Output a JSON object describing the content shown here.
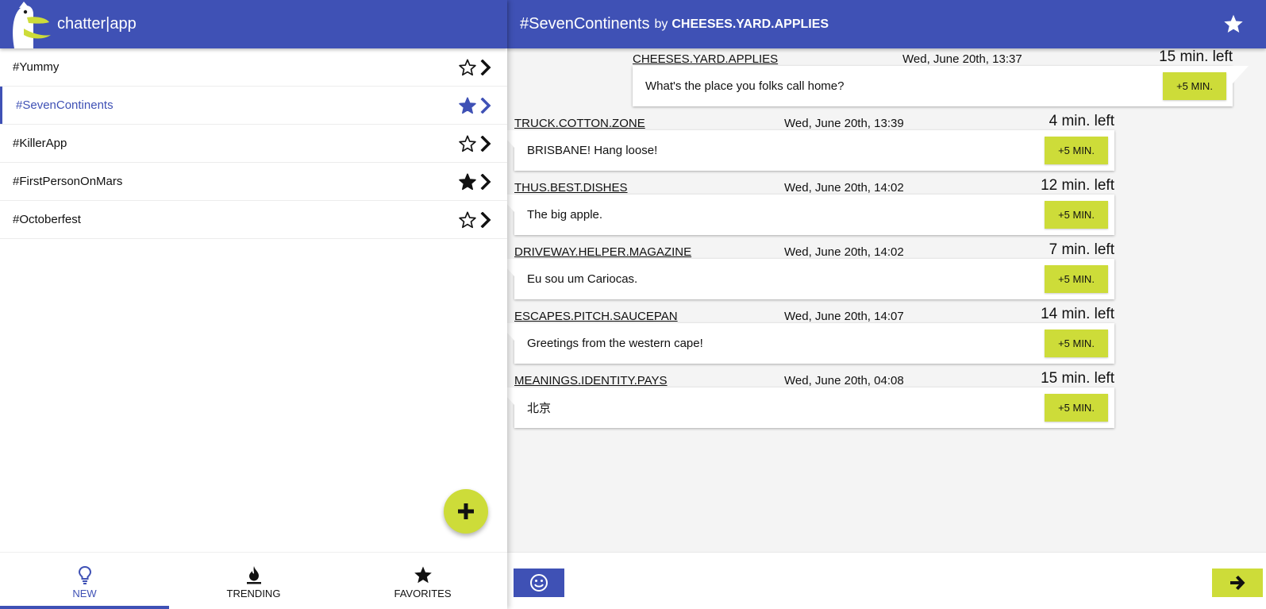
{
  "app": {
    "title": "chatter|app"
  },
  "colors": {
    "primary": "#3f51b5",
    "accent": "#cddc39"
  },
  "channels": [
    {
      "name": "#Yummy",
      "favorite": false,
      "active": false
    },
    {
      "name": "#SevenContinents",
      "favorite": true,
      "active": true
    },
    {
      "name": "#KillerApp",
      "favorite": false,
      "active": false
    },
    {
      "name": "#FirstPersonOnMars",
      "favorite": true,
      "active": false
    },
    {
      "name": "#Octoberfest",
      "favorite": false,
      "active": false
    }
  ],
  "icons": {
    "star_outline": "star-outline-icon",
    "star_filled": "star-filled-icon",
    "chevron": "chevron-right-icon",
    "add": "plus-icon",
    "new": "lightbulb-icon",
    "trending": "flame-icon",
    "favorites": "star-icon",
    "emoji": "smiley-icon",
    "send": "arrow-right-icon"
  },
  "bottom_nav": [
    {
      "label": "NEW",
      "icon": "lightbulb-icon",
      "active": true
    },
    {
      "label": "TRENDING",
      "icon": "flame-icon",
      "active": false
    },
    {
      "label": "FAVORITES",
      "icon": "star-icon",
      "active": false
    }
  ],
  "conversation": {
    "channel": "#SevenContinents",
    "by": "by",
    "author": "CHEESES.YARD.APPLIES",
    "header_favorite": true
  },
  "messages": [
    {
      "user": "CHEESES.YARD.APPLIES",
      "time": "Wed, June 20th, 13:37",
      "left": "15 min. left",
      "text": "What's the place you folks call home?",
      "button": "+5 MIN.",
      "mine": true
    },
    {
      "user": "TRUCK.COTTON.ZONE",
      "time": "Wed, June 20th, 13:39",
      "left": "4 min. left",
      "text": "BRISBANE! Hang loose!",
      "button": "+5 MIN.",
      "mine": false
    },
    {
      "user": "THUS.BEST.DISHES",
      "time": "Wed, June 20th, 14:02",
      "left": "12 min. left",
      "text": "The big apple.",
      "button": "+5 MIN.",
      "mine": false
    },
    {
      "user": "DRIVEWAY.HELPER.MAGAZINE",
      "time": "Wed, June 20th, 14:02",
      "left": "7 min. left",
      "text": "Eu sou um Cariocas.",
      "button": "+5 MIN.",
      "mine": false
    },
    {
      "user": "ESCAPES.PITCH.SAUCEPAN",
      "time": "Wed, June 20th, 14:07",
      "left": "14 min. left",
      "text": "Greetings from the western cape!",
      "button": "+5 MIN.",
      "mine": false
    },
    {
      "user": "MEANINGS.IDENTITY.PAYS",
      "time": "Wed, June 20th, 04:08",
      "left": "15 min. left",
      "text": "北京",
      "button": "+5 MIN.",
      "mine": false
    }
  ],
  "composer": {
    "value": "",
    "placeholder": ""
  }
}
